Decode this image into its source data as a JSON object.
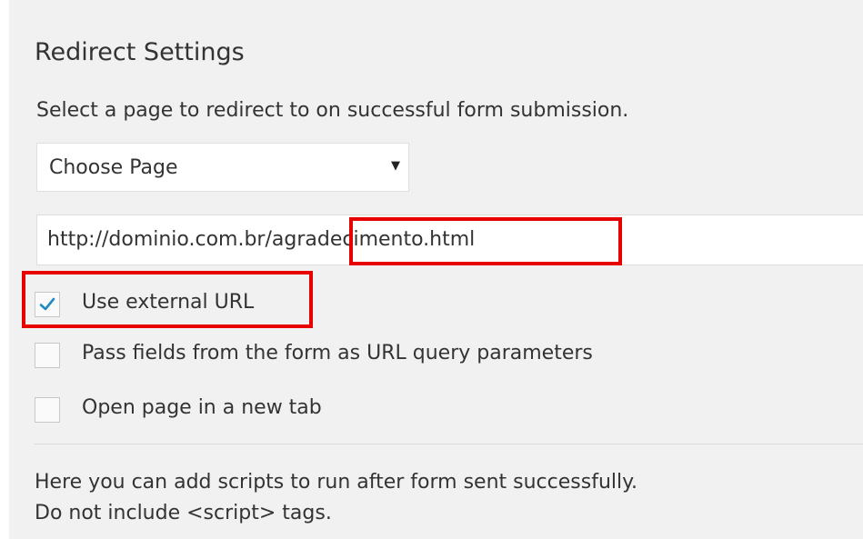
{
  "section": {
    "title": "Redirect Settings",
    "description": "Select a page to redirect to on successful form submission."
  },
  "page_select": {
    "selected": "Choose Page",
    "arrow_icon": "triangle-down-icon"
  },
  "url_field": {
    "value": "http://dominio.com.br/agradecimento.html"
  },
  "options": [
    {
      "label": "Use external URL",
      "checked": true
    },
    {
      "label": "Pass fields from the form as URL query parameters",
      "checked": false
    },
    {
      "label": "Open page in a new tab",
      "checked": false
    }
  ],
  "scripts_help": {
    "line1": "Here you can add scripts to run after form sent successfully.",
    "line2": "Do not include <script> tags."
  },
  "colors": {
    "panel_bg": "#f1f1f1",
    "highlight": "#e60000",
    "check_mark": "#1e8cbe",
    "text": "#333333"
  }
}
